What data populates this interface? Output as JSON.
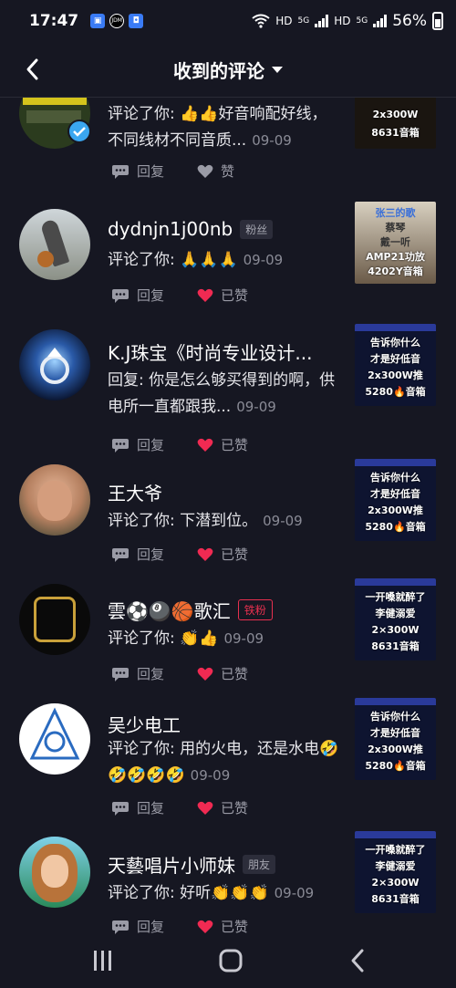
{
  "status_bar": {
    "time": "17:47",
    "battery_pct": "56%",
    "net1": "HD",
    "net2": "HD",
    "gen1": "5G",
    "gen2": "5G",
    "jdm_label": "JDM",
    "battery_level": 0.56
  },
  "header": {
    "title": "收到的评论"
  },
  "comments": [
    {
      "name": "",
      "tag": "",
      "text": "评论了你: 👍👍好音响配好线，不同线材不同音质...",
      "date": "09-09",
      "reply_label": "回复",
      "like_label": "赞",
      "liked": false,
      "thumb_lines": [
        "2x300W",
        "8631音箱"
      ]
    },
    {
      "name": "dydnjn1j00nb",
      "tag": "粉丝",
      "text": "评论了你: 🙏🙏🙏",
      "date": "09-09",
      "reply_label": "回复",
      "like_label": "已赞",
      "liked": true,
      "thumb_lines": [
        "张三的歌",
        "蔡琴",
        "戴一听",
        "AMP21功放",
        "4202Y音箱"
      ]
    },
    {
      "name": "K.J珠宝《时尚专业设计...",
      "tag": "",
      "text": "回复: 你是怎么够买得到的啊，供电所一直都跟我...",
      "date": "09-09",
      "reply_label": "回复",
      "like_label": "已赞",
      "liked": true,
      "thumb_lines": [
        "告诉你什么",
        "才是好低音",
        "2x300W推",
        "5280🔥音箱"
      ]
    },
    {
      "name": "王大爷",
      "tag": "",
      "text": "评论了你: 下潜到位。",
      "date": "09-09",
      "reply_label": "回复",
      "like_label": "已赞",
      "liked": true,
      "thumb_lines": [
        "告诉你什么",
        "才是好低音",
        "2x300W推",
        "5280🔥音箱"
      ]
    },
    {
      "name": "雲⚽🎱🏀歌汇",
      "tag": "铁粉",
      "text": "评论了你: 👏👍",
      "date": "09-09",
      "reply_label": "回复",
      "like_label": "已赞",
      "liked": true,
      "thumb_lines": [
        "一开嗓就醉了",
        "李健溺爱",
        "2×300W",
        "8631音箱"
      ]
    },
    {
      "name": "吴少电工",
      "tag": "",
      "text": "评论了你: 用的火电，还是水电🤣🤣🤣🤣🤣",
      "date": "09-09",
      "reply_label": "回复",
      "like_label": "已赞",
      "liked": true,
      "thumb_lines": [
        "告诉你什么",
        "才是好低音",
        "2x300W推",
        "5280🔥音箱"
      ]
    },
    {
      "name": "天藝唱片小师妹",
      "tag": "朋友",
      "text": "评论了你: 好听👏👏👏",
      "date": "09-09",
      "reply_label": "回复",
      "like_label": "已赞",
      "liked": true,
      "thumb_lines": [
        "一开嗓就醉了",
        "李健溺爱",
        "2×300W",
        "8631音箱"
      ]
    }
  ]
}
